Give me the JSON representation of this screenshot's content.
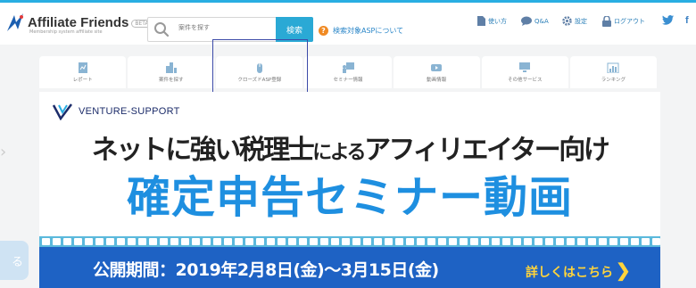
{
  "header": {
    "brand": "Affiliate Friends",
    "tagline": "Membership system affiliate site",
    "beta": "BETA",
    "search": {
      "placeholder": "案件を探す",
      "button_label": "検索"
    },
    "asp_link": "検索対象ASPについて",
    "utility": [
      {
        "label": "使い方",
        "icon": "document-icon"
      },
      {
        "label": "Q&A",
        "icon": "chat-icon"
      },
      {
        "label": "設定",
        "icon": "gear-icon"
      },
      {
        "label": "ログアウト",
        "icon": "lock-icon"
      }
    ],
    "social": [
      "twitter-icon",
      "facebook-icon"
    ]
  },
  "nav": [
    {
      "label": "レポート",
      "icon": "report-icon"
    },
    {
      "label": "案件を探す",
      "icon": "buildings-icon"
    },
    {
      "label": "クローズドASP登録",
      "icon": "mouse-icon"
    },
    {
      "label": "セミナー情報",
      "icon": "seminar-icon"
    },
    {
      "label": "動画情報",
      "icon": "video-icon"
    },
    {
      "label": "その他サービス",
      "icon": "monitor-icon"
    },
    {
      "label": "ランキング",
      "icon": "chart-icon"
    }
  ],
  "banner": {
    "brand": "VENTURE-SUPPORT",
    "headline_part1": "ネットに",
    "headline_part2": "強い税理士",
    "headline_part3": "による",
    "headline_part4": "アフィリエイター向け",
    "title": "確定申告セミナー動画",
    "period": "公開期間：2019年2月8日(金)〜3月15日(金)",
    "details": "詳しくはこちら",
    "chevron": "❯"
  },
  "colors": {
    "accent": "#29aee2",
    "title_blue": "#1e8fe0",
    "strip_blue": "#1e62c4",
    "details_yellow": "#ffd43b",
    "highlight": "#3b4aa8"
  }
}
